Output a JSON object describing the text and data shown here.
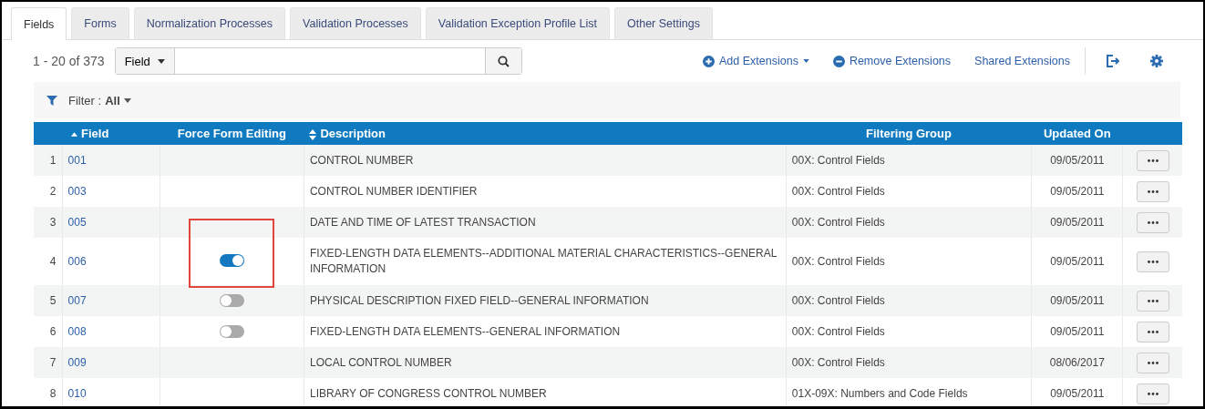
{
  "tabs": [
    {
      "label": "Fields",
      "selected": true
    },
    {
      "label": "Forms",
      "selected": false
    },
    {
      "label": "Normalization Processes",
      "selected": false
    },
    {
      "label": "Validation Processes",
      "selected": false
    },
    {
      "label": "Validation Exception Profile List",
      "selected": false
    },
    {
      "label": "Other Settings",
      "selected": false
    }
  ],
  "toolbar": {
    "count": "1 - 20 of 373",
    "search_scope": "Field",
    "actions": [
      {
        "label": "Add Extensions"
      },
      {
        "label": "Remove Extensions"
      },
      {
        "label": "Shared Extensions"
      }
    ]
  },
  "filter": {
    "label": "Filter :",
    "value": "All"
  },
  "table": {
    "columns": [
      {
        "label": "Field"
      },
      {
        "label": "Force Form Editing"
      },
      {
        "label": "Description"
      },
      {
        "label": "Filtering Group"
      },
      {
        "label": "Updated On"
      }
    ],
    "rows": [
      {
        "index": "1",
        "field": "001",
        "description": "CONTROL NUMBER",
        "group": "00X: Control Fields",
        "updated": "09/05/2011"
      },
      {
        "index": "2",
        "field": "003",
        "description": "CONTROL NUMBER IDENTIFIER",
        "group": "00X: Control Fields",
        "updated": "09/05/2011"
      },
      {
        "index": "3",
        "field": "005",
        "description": "DATE AND TIME OF LATEST TRANSACTION",
        "group": "00X: Control Fields",
        "updated": "09/05/2011"
      },
      {
        "index": "4",
        "field": "006",
        "force_edit": {
          "on": true,
          "highlighted": true
        },
        "description": "FIXED-LENGTH DATA ELEMENTS--ADDITIONAL MATERIAL CHARACTERISTICS--GENERAL INFORMATION",
        "group": "00X: Control Fields",
        "updated": "09/05/2011"
      },
      {
        "index": "5",
        "field": "007",
        "force_edit": {
          "on": false,
          "highlighted": false
        },
        "description": "PHYSICAL DESCRIPTION FIXED FIELD--GENERAL INFORMATION",
        "group": "00X: Control Fields",
        "updated": "09/05/2011"
      },
      {
        "index": "6",
        "field": "008",
        "force_edit": {
          "on": false,
          "highlighted": false
        },
        "description": "FIXED-LENGTH DATA ELEMENTS--GENERAL INFORMATION",
        "group": "00X: Control Fields",
        "updated": "09/05/2011"
      },
      {
        "index": "7",
        "field": "009",
        "description": "LOCAL CONTROL NUMBER",
        "group": "00X: Control Fields",
        "updated": "08/06/2017"
      },
      {
        "index": "8",
        "field": "010",
        "description": "LIBRARY OF CONGRESS CONTROL NUMBER",
        "group": "01X-09X: Numbers and Code Fields",
        "updated": "09/05/2011"
      }
    ]
  }
}
